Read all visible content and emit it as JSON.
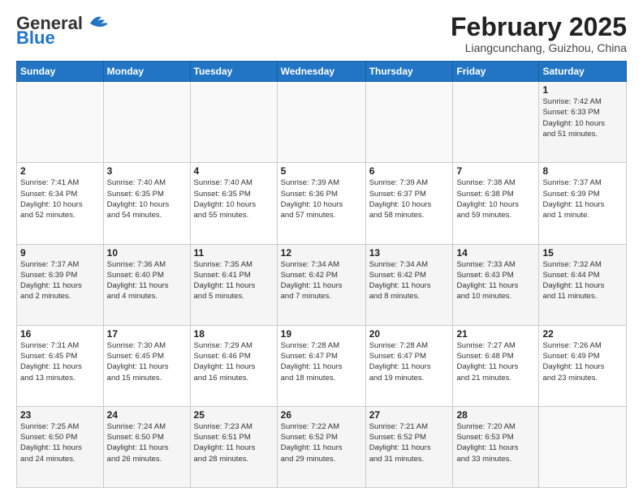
{
  "header": {
    "logo_general": "General",
    "logo_blue": "Blue",
    "month_title": "February 2025",
    "location": "Liangcunchang, Guizhou, China"
  },
  "weekdays": [
    "Sunday",
    "Monday",
    "Tuesday",
    "Wednesday",
    "Thursday",
    "Friday",
    "Saturday"
  ],
  "weeks": [
    [
      {
        "day": "",
        "detail": ""
      },
      {
        "day": "",
        "detail": ""
      },
      {
        "day": "",
        "detail": ""
      },
      {
        "day": "",
        "detail": ""
      },
      {
        "day": "",
        "detail": ""
      },
      {
        "day": "",
        "detail": ""
      },
      {
        "day": "1",
        "detail": "Sunrise: 7:42 AM\nSunset: 6:33 PM\nDaylight: 10 hours\nand 51 minutes."
      }
    ],
    [
      {
        "day": "2",
        "detail": "Sunrise: 7:41 AM\nSunset: 6:34 PM\nDaylight: 10 hours\nand 52 minutes."
      },
      {
        "day": "3",
        "detail": "Sunrise: 7:40 AM\nSunset: 6:35 PM\nDaylight: 10 hours\nand 54 minutes."
      },
      {
        "day": "4",
        "detail": "Sunrise: 7:40 AM\nSunset: 6:35 PM\nDaylight: 10 hours\nand 55 minutes."
      },
      {
        "day": "5",
        "detail": "Sunrise: 7:39 AM\nSunset: 6:36 PM\nDaylight: 10 hours\nand 57 minutes."
      },
      {
        "day": "6",
        "detail": "Sunrise: 7:39 AM\nSunset: 6:37 PM\nDaylight: 10 hours\nand 58 minutes."
      },
      {
        "day": "7",
        "detail": "Sunrise: 7:38 AM\nSunset: 6:38 PM\nDaylight: 10 hours\nand 59 minutes."
      },
      {
        "day": "8",
        "detail": "Sunrise: 7:37 AM\nSunset: 6:39 PM\nDaylight: 11 hours\nand 1 minute."
      }
    ],
    [
      {
        "day": "9",
        "detail": "Sunrise: 7:37 AM\nSunset: 6:39 PM\nDaylight: 11 hours\nand 2 minutes."
      },
      {
        "day": "10",
        "detail": "Sunrise: 7:36 AM\nSunset: 6:40 PM\nDaylight: 11 hours\nand 4 minutes."
      },
      {
        "day": "11",
        "detail": "Sunrise: 7:35 AM\nSunset: 6:41 PM\nDaylight: 11 hours\nand 5 minutes."
      },
      {
        "day": "12",
        "detail": "Sunrise: 7:34 AM\nSunset: 6:42 PM\nDaylight: 11 hours\nand 7 minutes."
      },
      {
        "day": "13",
        "detail": "Sunrise: 7:34 AM\nSunset: 6:42 PM\nDaylight: 11 hours\nand 8 minutes."
      },
      {
        "day": "14",
        "detail": "Sunrise: 7:33 AM\nSunset: 6:43 PM\nDaylight: 11 hours\nand 10 minutes."
      },
      {
        "day": "15",
        "detail": "Sunrise: 7:32 AM\nSunset: 6:44 PM\nDaylight: 11 hours\nand 11 minutes."
      }
    ],
    [
      {
        "day": "16",
        "detail": "Sunrise: 7:31 AM\nSunset: 6:45 PM\nDaylight: 11 hours\nand 13 minutes."
      },
      {
        "day": "17",
        "detail": "Sunrise: 7:30 AM\nSunset: 6:45 PM\nDaylight: 11 hours\nand 15 minutes."
      },
      {
        "day": "18",
        "detail": "Sunrise: 7:29 AM\nSunset: 6:46 PM\nDaylight: 11 hours\nand 16 minutes."
      },
      {
        "day": "19",
        "detail": "Sunrise: 7:28 AM\nSunset: 6:47 PM\nDaylight: 11 hours\nand 18 minutes."
      },
      {
        "day": "20",
        "detail": "Sunrise: 7:28 AM\nSunset: 6:47 PM\nDaylight: 11 hours\nand 19 minutes."
      },
      {
        "day": "21",
        "detail": "Sunrise: 7:27 AM\nSunset: 6:48 PM\nDaylight: 11 hours\nand 21 minutes."
      },
      {
        "day": "22",
        "detail": "Sunrise: 7:26 AM\nSunset: 6:49 PM\nDaylight: 11 hours\nand 23 minutes."
      }
    ],
    [
      {
        "day": "23",
        "detail": "Sunrise: 7:25 AM\nSunset: 6:50 PM\nDaylight: 11 hours\nand 24 minutes."
      },
      {
        "day": "24",
        "detail": "Sunrise: 7:24 AM\nSunset: 6:50 PM\nDaylight: 11 hours\nand 26 minutes."
      },
      {
        "day": "25",
        "detail": "Sunrise: 7:23 AM\nSunset: 6:51 PM\nDaylight: 11 hours\nand 28 minutes."
      },
      {
        "day": "26",
        "detail": "Sunrise: 7:22 AM\nSunset: 6:52 PM\nDaylight: 11 hours\nand 29 minutes."
      },
      {
        "day": "27",
        "detail": "Sunrise: 7:21 AM\nSunset: 6:52 PM\nDaylight: 11 hours\nand 31 minutes."
      },
      {
        "day": "28",
        "detail": "Sunrise: 7:20 AM\nSunset: 6:53 PM\nDaylight: 11 hours\nand 33 minutes."
      },
      {
        "day": "",
        "detail": ""
      }
    ]
  ]
}
